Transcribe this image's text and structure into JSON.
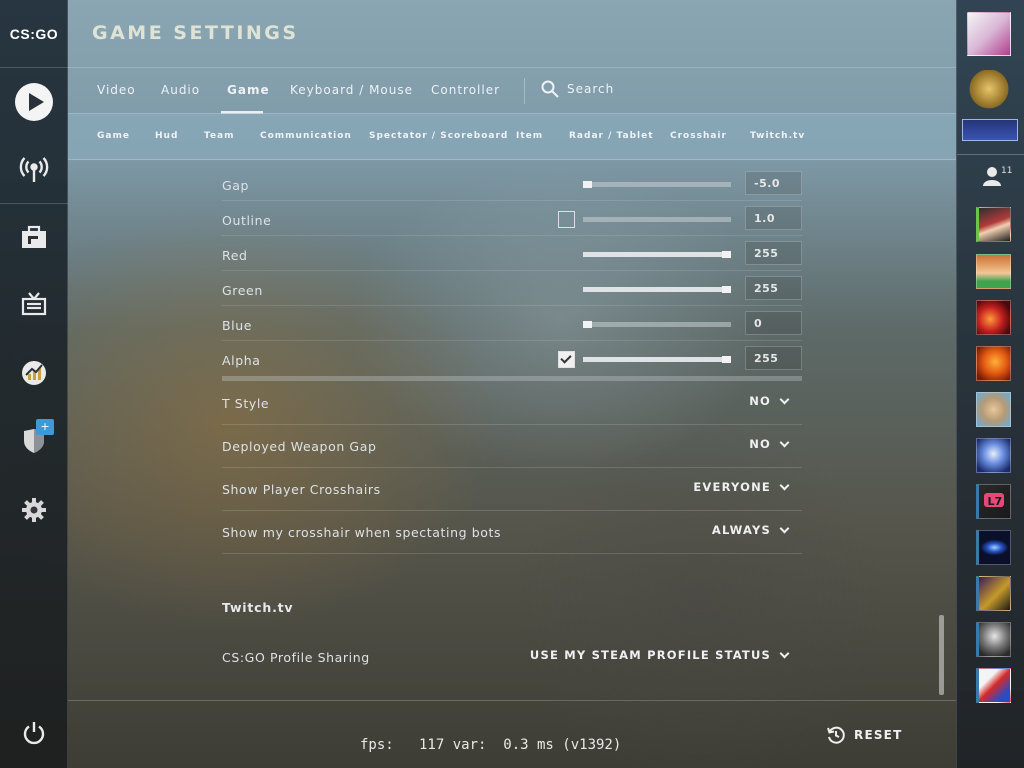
{
  "app": {
    "logo_text": "CS:GO",
    "title": "GAME SETTINGS"
  },
  "left_nav": [
    "play-icon",
    "broadcast-icon",
    "inventory-icon",
    "watch-tv-icon",
    "stats-icon",
    "shield-icon",
    "settings-icon",
    "power-icon"
  ],
  "left_nav_badge": "+",
  "main_tabs": [
    {
      "label": "Video"
    },
    {
      "label": "Audio"
    },
    {
      "label": "Game",
      "active": true
    },
    {
      "label": "Keyboard / Mouse"
    },
    {
      "label": "Controller"
    }
  ],
  "search_label": "Search",
  "sub_tabs": [
    "Game",
    "Hud",
    "Team",
    "Communication",
    "Spectator / Scoreboard",
    "Item",
    "Radar / Tablet",
    "Crosshair",
    "Twitch.tv"
  ],
  "slider_rows": [
    {
      "label": "Gap",
      "value": "-5.0",
      "fraction": 0.0,
      "checkbox": null
    },
    {
      "label": "Outline",
      "value": "1.0",
      "fraction": null,
      "checkbox": "unchecked"
    },
    {
      "label": "Red",
      "value": "255",
      "fraction": 1.0,
      "checkbox": null
    },
    {
      "label": "Green",
      "value": "255",
      "fraction": 1.0,
      "checkbox": null
    },
    {
      "label": "Blue",
      "value": "0",
      "fraction": 0.0,
      "checkbox": null
    },
    {
      "label": "Alpha",
      "value": "255",
      "fraction": 1.0,
      "checkbox": "checked"
    }
  ],
  "dropdown_rows": [
    {
      "label": "T Style",
      "value": "NO"
    },
    {
      "label": "Deployed Weapon Gap",
      "value": "NO"
    },
    {
      "label": "Show Player Crosshairs",
      "value": "EVERYONE"
    },
    {
      "label": "Show my crosshair when spectating bots",
      "value": "ALWAYS"
    }
  ],
  "twitch": {
    "section_title": "Twitch.tv",
    "profile_sharing_label": "CS:GO Profile Sharing",
    "profile_sharing_value": "USE MY STEAM PROFILE STATUS"
  },
  "footer": {
    "fps_text": "fps:   117 var:  0.3 ms (v1392)",
    "reset_label": "RESET"
  },
  "friends": {
    "count": "11"
  },
  "colors": {
    "accent_blue": "#3e9ad6",
    "text": "#dde2e6"
  }
}
